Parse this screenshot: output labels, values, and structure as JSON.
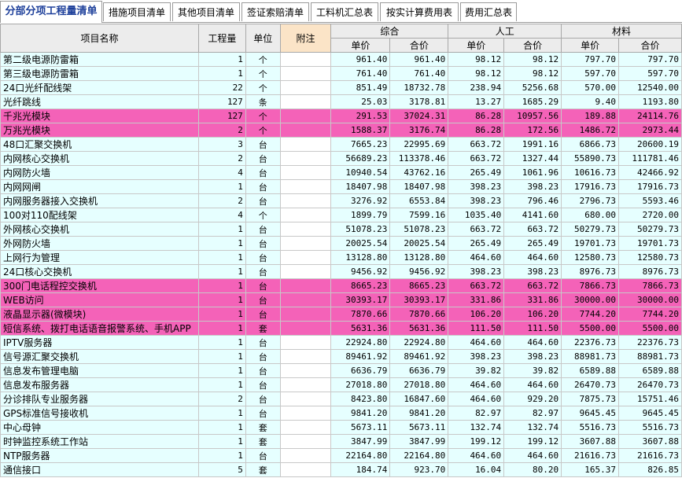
{
  "tabs": [
    {
      "label": "分部分项工程量清单",
      "active": true
    },
    {
      "label": "措施项目清单",
      "active": false
    },
    {
      "label": "其他项目清单",
      "active": false
    },
    {
      "label": "签证索赔清单",
      "active": false
    },
    {
      "label": "工料机汇总表",
      "active": false
    },
    {
      "label": "按实计算费用表",
      "active": false
    },
    {
      "label": "费用汇总表",
      "active": false
    }
  ],
  "headers": {
    "name": "项目名称",
    "qty": "工程量",
    "unit": "单位",
    "note": "附注",
    "group_total": "综合",
    "group_labor": "人工",
    "group_material": "材料",
    "unit_price": "单价",
    "total_price": "合价"
  },
  "colors": {
    "row_bg": "#e6ffff",
    "highlight": "#f462b8",
    "header_bg": "#ececec",
    "note_header": "#fbe4c7",
    "active_tab_text": "#1d3f9a"
  },
  "rows": [
    {
      "name": "第二级电源防雷箱",
      "qty": "1",
      "unit": "个",
      "c1": "961.40",
      "c2": "961.40",
      "l1": "98.12",
      "l2": "98.12",
      "m1": "797.70",
      "m2": "797.70",
      "hl": false
    },
    {
      "name": "第三级电源防雷箱",
      "qty": "1",
      "unit": "个",
      "c1": "761.40",
      "c2": "761.40",
      "l1": "98.12",
      "l2": "98.12",
      "m1": "597.70",
      "m2": "597.70",
      "hl": false
    },
    {
      "name": "24口光纤配线架",
      "qty": "22",
      "unit": "个",
      "c1": "851.49",
      "c2": "18732.78",
      "l1": "238.94",
      "l2": "5256.68",
      "m1": "570.00",
      "m2": "12540.00",
      "hl": false
    },
    {
      "name": "光纤跳线",
      "qty": "127",
      "unit": "条",
      "c1": "25.03",
      "c2": "3178.81",
      "l1": "13.27",
      "l2": "1685.29",
      "m1": "9.40",
      "m2": "1193.80",
      "hl": false
    },
    {
      "name": "千兆光模块",
      "qty": "127",
      "unit": "个",
      "c1": "291.53",
      "c2": "37024.31",
      "l1": "86.28",
      "l2": "10957.56",
      "m1": "189.88",
      "m2": "24114.76",
      "hl": true
    },
    {
      "name": "万兆光模块",
      "qty": "2",
      "unit": "个",
      "c1": "1588.37",
      "c2": "3176.74",
      "l1": "86.28",
      "l2": "172.56",
      "m1": "1486.72",
      "m2": "2973.44",
      "hl": true
    },
    {
      "name": "48口汇聚交换机",
      "qty": "3",
      "unit": "台",
      "c1": "7665.23",
      "c2": "22995.69",
      "l1": "663.72",
      "l2": "1991.16",
      "m1": "6866.73",
      "m2": "20600.19",
      "hl": false
    },
    {
      "name": "内网核心交换机",
      "qty": "2",
      "unit": "台",
      "c1": "56689.23",
      "c2": "113378.46",
      "l1": "663.72",
      "l2": "1327.44",
      "m1": "55890.73",
      "m2": "111781.46",
      "hl": false
    },
    {
      "name": "内网防火墙",
      "qty": "4",
      "unit": "台",
      "c1": "10940.54",
      "c2": "43762.16",
      "l1": "265.49",
      "l2": "1061.96",
      "m1": "10616.73",
      "m2": "42466.92",
      "hl": false
    },
    {
      "name": "内网网闸",
      "qty": "1",
      "unit": "台",
      "c1": "18407.98",
      "c2": "18407.98",
      "l1": "398.23",
      "l2": "398.23",
      "m1": "17916.73",
      "m2": "17916.73",
      "hl": false
    },
    {
      "name": "内网服务器接入交换机",
      "qty": "2",
      "unit": "台",
      "c1": "3276.92",
      "c2": "6553.84",
      "l1": "398.23",
      "l2": "796.46",
      "m1": "2796.73",
      "m2": "5593.46",
      "hl": false
    },
    {
      "name": "100对110配线架",
      "qty": "4",
      "unit": "个",
      "c1": "1899.79",
      "c2": "7599.16",
      "l1": "1035.40",
      "l2": "4141.60",
      "m1": "680.00",
      "m2": "2720.00",
      "hl": false
    },
    {
      "name": "外网核心交换机",
      "qty": "1",
      "unit": "台",
      "c1": "51078.23",
      "c2": "51078.23",
      "l1": "663.72",
      "l2": "663.72",
      "m1": "50279.73",
      "m2": "50279.73",
      "hl": false
    },
    {
      "name": "外网防火墙",
      "qty": "1",
      "unit": "台",
      "c1": "20025.54",
      "c2": "20025.54",
      "l1": "265.49",
      "l2": "265.49",
      "m1": "19701.73",
      "m2": "19701.73",
      "hl": false
    },
    {
      "name": "上网行为管理",
      "qty": "1",
      "unit": "台",
      "c1": "13128.80",
      "c2": "13128.80",
      "l1": "464.60",
      "l2": "464.60",
      "m1": "12580.73",
      "m2": "12580.73",
      "hl": false
    },
    {
      "name": "24口核心交换机",
      "qty": "1",
      "unit": "台",
      "c1": "9456.92",
      "c2": "9456.92",
      "l1": "398.23",
      "l2": "398.23",
      "m1": "8976.73",
      "m2": "8976.73",
      "hl": false
    },
    {
      "name": "300门电话程控交换机",
      "qty": "1",
      "unit": "台",
      "c1": "8665.23",
      "c2": "8665.23",
      "l1": "663.72",
      "l2": "663.72",
      "m1": "7866.73",
      "m2": "7866.73",
      "hl": true
    },
    {
      "name": "WEB访问",
      "qty": "1",
      "unit": "台",
      "c1": "30393.17",
      "c2": "30393.17",
      "l1": "331.86",
      "l2": "331.86",
      "m1": "30000.00",
      "m2": "30000.00",
      "hl": true
    },
    {
      "name": "液晶显示器(微模块)",
      "qty": "1",
      "unit": "台",
      "c1": "7870.66",
      "c2": "7870.66",
      "l1": "106.20",
      "l2": "106.20",
      "m1": "7744.20",
      "m2": "7744.20",
      "hl": true
    },
    {
      "name": "短信系统、拨打电话语音报警系统、手机APP",
      "qty": "1",
      "unit": "套",
      "c1": "5631.36",
      "c2": "5631.36",
      "l1": "111.50",
      "l2": "111.50",
      "m1": "5500.00",
      "m2": "5500.00",
      "hl": true
    },
    {
      "name": "IPTV服务器",
      "qty": "1",
      "unit": "台",
      "c1": "22924.80",
      "c2": "22924.80",
      "l1": "464.60",
      "l2": "464.60",
      "m1": "22376.73",
      "m2": "22376.73",
      "hl": false
    },
    {
      "name": "信号源汇聚交换机",
      "qty": "1",
      "unit": "台",
      "c1": "89461.92",
      "c2": "89461.92",
      "l1": "398.23",
      "l2": "398.23",
      "m1": "88981.73",
      "m2": "88981.73",
      "hl": false
    },
    {
      "name": "信息发布管理电脑",
      "qty": "1",
      "unit": "台",
      "c1": "6636.79",
      "c2": "6636.79",
      "l1": "39.82",
      "l2": "39.82",
      "m1": "6589.88",
      "m2": "6589.88",
      "hl": false
    },
    {
      "name": "信息发布服务器",
      "qty": "1",
      "unit": "台",
      "c1": "27018.80",
      "c2": "27018.80",
      "l1": "464.60",
      "l2": "464.60",
      "m1": "26470.73",
      "m2": "26470.73",
      "hl": false
    },
    {
      "name": "分诊排队专业服务器",
      "qty": "2",
      "unit": "台",
      "c1": "8423.80",
      "c2": "16847.60",
      "l1": "464.60",
      "l2": "929.20",
      "m1": "7875.73",
      "m2": "15751.46",
      "hl": false
    },
    {
      "name": "GPS标准信号接收机",
      "qty": "1",
      "unit": "台",
      "c1": "9841.20",
      "c2": "9841.20",
      "l1": "82.97",
      "l2": "82.97",
      "m1": "9645.45",
      "m2": "9645.45",
      "hl": false
    },
    {
      "name": "中心母钟",
      "qty": "1",
      "unit": "套",
      "c1": "5673.11",
      "c2": "5673.11",
      "l1": "132.74",
      "l2": "132.74",
      "m1": "5516.73",
      "m2": "5516.73",
      "hl": false
    },
    {
      "name": "时钟监控系统工作站",
      "qty": "1",
      "unit": "套",
      "c1": "3847.99",
      "c2": "3847.99",
      "l1": "199.12",
      "l2": "199.12",
      "m1": "3607.88",
      "m2": "3607.88",
      "hl": false
    },
    {
      "name": "NTP服务器",
      "qty": "1",
      "unit": "台",
      "c1": "22164.80",
      "c2": "22164.80",
      "l1": "464.60",
      "l2": "464.60",
      "m1": "21616.73",
      "m2": "21616.73",
      "hl": false
    },
    {
      "name": "通信接口",
      "qty": "5",
      "unit": "套",
      "c1": "184.74",
      "c2": "923.70",
      "l1": "16.04",
      "l2": "80.20",
      "m1": "165.37",
      "m2": "826.85",
      "hl": false
    }
  ]
}
